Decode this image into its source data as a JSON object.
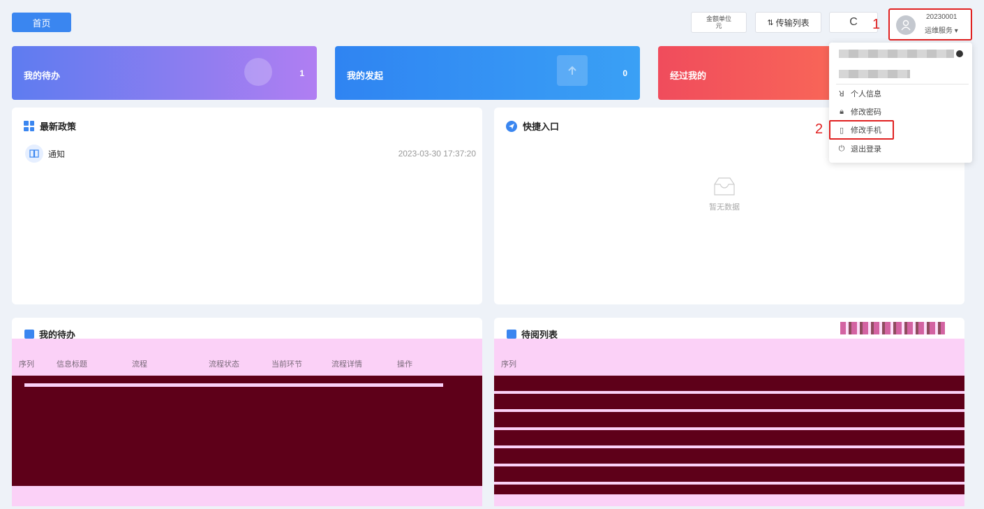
{
  "topbar": {
    "home_label": "首页",
    "unit_line1": "金额单位",
    "unit_line2": "元",
    "transfer_label": "传输列表",
    "refresh_symbol": "C",
    "callout_1": "1",
    "callout_2": "2",
    "user_id": "20230001",
    "user_role": "运维服务 ▾"
  },
  "stats": [
    {
      "label": "我的待办",
      "count": "1"
    },
    {
      "label": "我的发起",
      "count": "0"
    },
    {
      "label": "经过我的",
      "count": ""
    }
  ],
  "policy": {
    "title": "最新政策",
    "items": [
      {
        "title": "通知",
        "time": "2023-03-30 17:37:20"
      }
    ]
  },
  "quick": {
    "title": "快捷入口",
    "empty_text": "暂无数据"
  },
  "dropdown": {
    "items": [
      {
        "icon": "user-icon",
        "label": "个人信息"
      },
      {
        "icon": "lock-icon",
        "label": "修改密码"
      },
      {
        "icon": "phone-icon",
        "label": "修改手机"
      },
      {
        "icon": "power-icon",
        "label": "退出登录"
      }
    ]
  },
  "todo": {
    "title": "我的待办",
    "columns": [
      "序列",
      "信息标题",
      "流程",
      "流程状态",
      "当前环节",
      "流程详情",
      "操作"
    ]
  },
  "pending": {
    "title": "待阅列表",
    "columns": [
      "序列"
    ]
  },
  "colors": {
    "accent": "#3a86f0",
    "highlight": "#e02020"
  }
}
